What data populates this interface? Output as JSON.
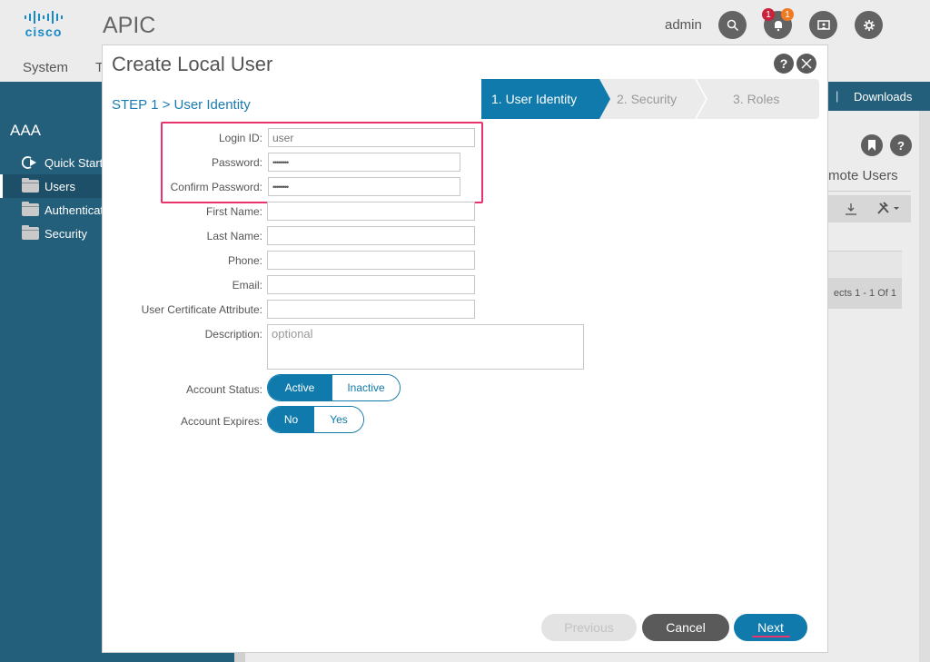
{
  "header": {
    "brand": "cisco",
    "app_title": "APIC",
    "user": "admin",
    "icons": {
      "search": "search-icon",
      "notifications": "bell-icon",
      "display": "monitor-user-icon",
      "settings": "gear-icon"
    },
    "badges": {
      "critical": "1",
      "warning": "1"
    },
    "badge_colors": {
      "critical": "#c8223c",
      "warning": "#f07a22"
    },
    "nav_tabs": [
      "System",
      "T"
    ],
    "downloads_label": "Downloads",
    "downloads_sep": "|"
  },
  "sidebar": {
    "title": "AAA",
    "items": [
      {
        "label": "Quick Start",
        "icon": "quick-start-icon",
        "active": false
      },
      {
        "label": "Users",
        "icon": "folder-icon",
        "active": true
      },
      {
        "label": "Authenticat",
        "icon": "folder-icon",
        "active": false
      },
      {
        "label": "Security",
        "icon": "folder-icon",
        "active": false
      }
    ]
  },
  "background_panel": {
    "tab_label": "mote Users",
    "pagination": "ects 1 - 1 Of 1",
    "icons": [
      "bookmark-icon",
      "help-icon",
      "download-icon",
      "tools-icon"
    ]
  },
  "dialog": {
    "title": "Create Local User",
    "step_label": "STEP 1 > User Identity",
    "wizard_steps": [
      {
        "label": "1. User Identity",
        "active": true
      },
      {
        "label": "2. Security",
        "active": false
      },
      {
        "label": "3. Roles",
        "active": false
      }
    ],
    "fields": {
      "login_id": {
        "label": "Login ID:",
        "value": "user"
      },
      "password": {
        "label": "Password:",
        "value": "••••••••"
      },
      "confirm_password": {
        "label": "Confirm Password:",
        "value": "••••••••"
      },
      "first_name": {
        "label": "First Name:",
        "value": ""
      },
      "last_name": {
        "label": "Last Name:",
        "value": ""
      },
      "phone": {
        "label": "Phone:",
        "value": ""
      },
      "email": {
        "label": "Email:",
        "value": ""
      },
      "cert_attr": {
        "label": "User Certificate Attribute:",
        "value": ""
      },
      "description": {
        "label": "Description:",
        "placeholder": "optional"
      }
    },
    "account_status": {
      "label": "Account Status:",
      "options": [
        "Active",
        "Inactive"
      ],
      "selected": "Active"
    },
    "account_expires": {
      "label": "Account Expires:",
      "options": [
        "No",
        "Yes"
      ],
      "selected": "No"
    },
    "buttons": {
      "previous": "Previous",
      "cancel": "Cancel",
      "next": "Next"
    },
    "highlight_color": "#e8336d",
    "accent_color": "#0f7aab"
  }
}
